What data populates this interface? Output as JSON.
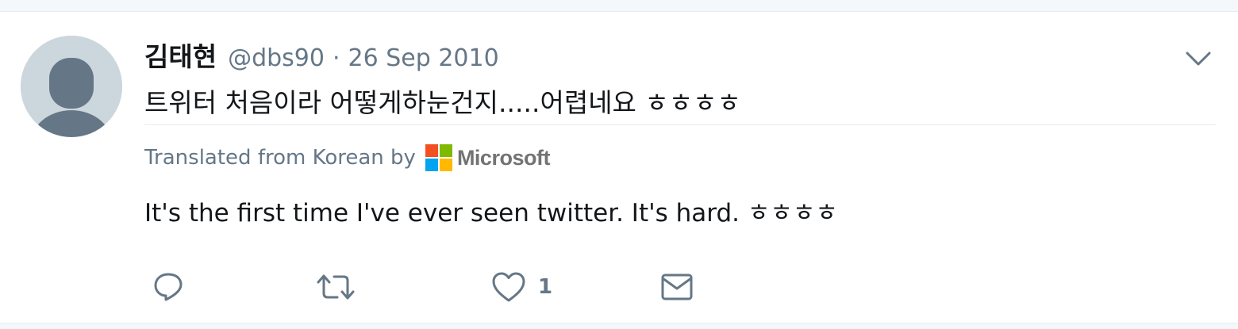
{
  "tweet": {
    "name": "김태현",
    "handle": "@dbs90",
    "separator": "·",
    "date": "26 Sep 2010",
    "text": "트위터 처음이라 어떻게하눈건지.....어렵네요 ㅎㅎㅎㅎ",
    "translation_label": "Translated from Korean by",
    "translator": "Microsoft",
    "translation": "It's the first time I've ever seen twitter. It's hard. ㅎㅎㅎㅎ"
  },
  "actions": {
    "like_count": "1"
  },
  "icons": {
    "menu": "chevron-down-icon",
    "reply": "reply-bubble-icon",
    "retweet": "retweet-icon",
    "like": "heart-icon",
    "dm": "envelope-icon",
    "avatar": "default-avatar-icon"
  },
  "colors": {
    "text_primary": "#14171a",
    "text_secondary": "#657786",
    "avatar_bg": "#ccd6dd",
    "avatar_fg": "#657786",
    "ms_red": "#f25022",
    "ms_green": "#7fba00",
    "ms_blue": "#00a4ef",
    "ms_yellow": "#ffb900"
  }
}
